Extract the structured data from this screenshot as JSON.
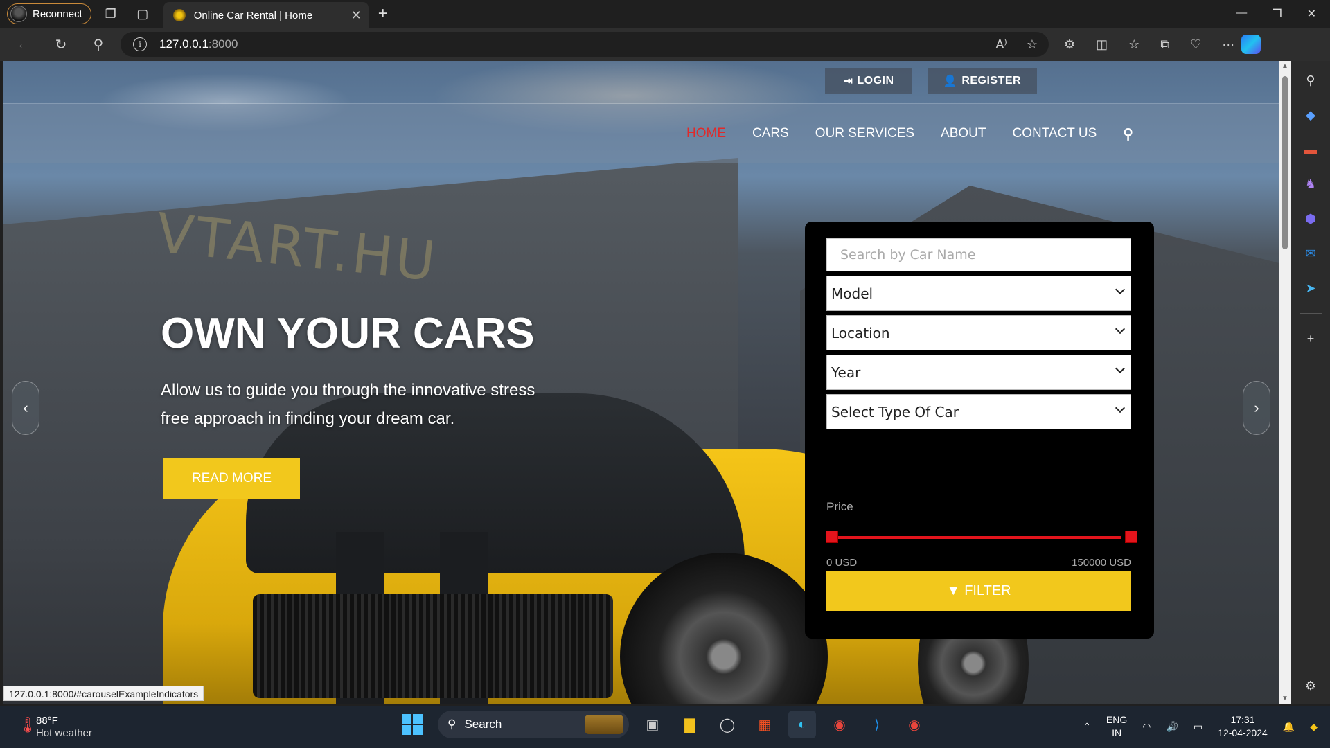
{
  "browser": {
    "profile_label": "Reconnect",
    "tab_title": "Online Car Rental | Home",
    "url_host": "127.0.0.1",
    "url_port": ":8000",
    "status_url": "127.0.0.1:8000/#carouselExampleIndicators"
  },
  "header": {
    "login_label": "LOGIN",
    "register_label": "REGISTER",
    "nav": [
      "HOME",
      "CARS",
      "OUR SERVICES",
      "ABOUT",
      "CONTACT US"
    ],
    "active_nav": "HOME"
  },
  "hero": {
    "watermark": "VTART.HU",
    "title": "OWN YOUR CARS",
    "subtitle": "Allow us to guide you through the innovative stress free approach in finding your dream car.",
    "read_more_label": "READ MORE"
  },
  "filter": {
    "search_placeholder": "Search by Car Name",
    "model_value": "Model",
    "location_value": "Location",
    "year_value": "Year",
    "type_value": "Select Type Of Car",
    "price_label": "Price",
    "price_min": "0 USD",
    "price_max": "150000 USD",
    "filter_label": "FILTER"
  },
  "taskbar": {
    "weather_temp": "88°F",
    "weather_desc": "Hot weather",
    "search_label": "Search",
    "lang_line1": "ENG",
    "lang_line2": "IN",
    "time": "17:31",
    "date": "12-04-2024"
  },
  "colors": {
    "accent_yellow": "#f2c81c",
    "nav_active_red": "#e02a2a",
    "slider_red": "#e3141c",
    "panel_black": "#000000"
  }
}
